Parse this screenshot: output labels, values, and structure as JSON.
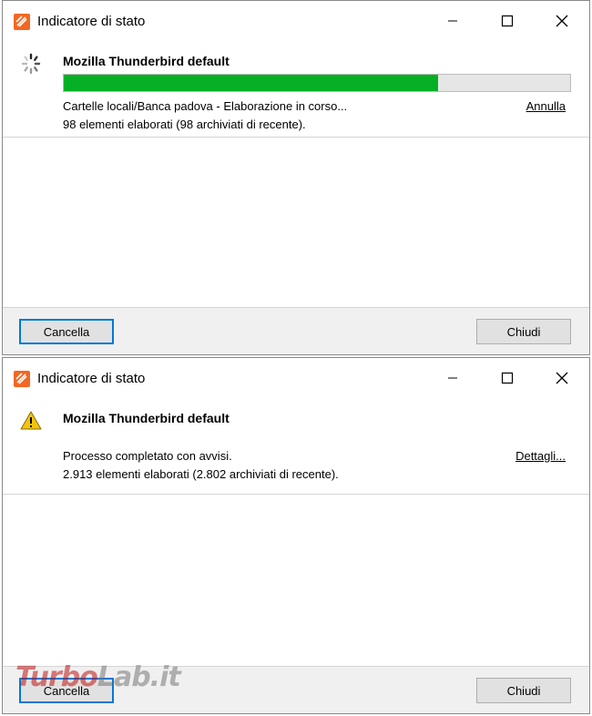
{
  "window1": {
    "title": "Indicatore di stato",
    "status_icon": "spinner-icon",
    "profile_name": "Mozilla Thunderbird default",
    "progress": 0.74,
    "status_line": "Cartelle locali/Banca padova - Elaborazione in corso...",
    "count_line": "98 elementi elaborati (98 archiviati di recente).",
    "link_label": "Annulla",
    "cancel_button": "Cancella",
    "close_button": "Chiudi"
  },
  "window2": {
    "title": "Indicatore di stato",
    "status_icon": "warning-icon",
    "profile_name": "Mozilla Thunderbird default",
    "status_line": "Processo completato con avvisi.",
    "count_line": "2.913 elementi elaborati (2.802 archiviati di recente).",
    "link_label": "Dettagli...",
    "cancel_button": "Cancella",
    "close_button": "Chiudi"
  },
  "watermark": {
    "part1": "Turbo",
    "part2": "Lab.it"
  },
  "colors": {
    "progress": "#06b025",
    "accent": "#0078d7",
    "icon": "#f26722",
    "warning": "#f2c40f"
  }
}
